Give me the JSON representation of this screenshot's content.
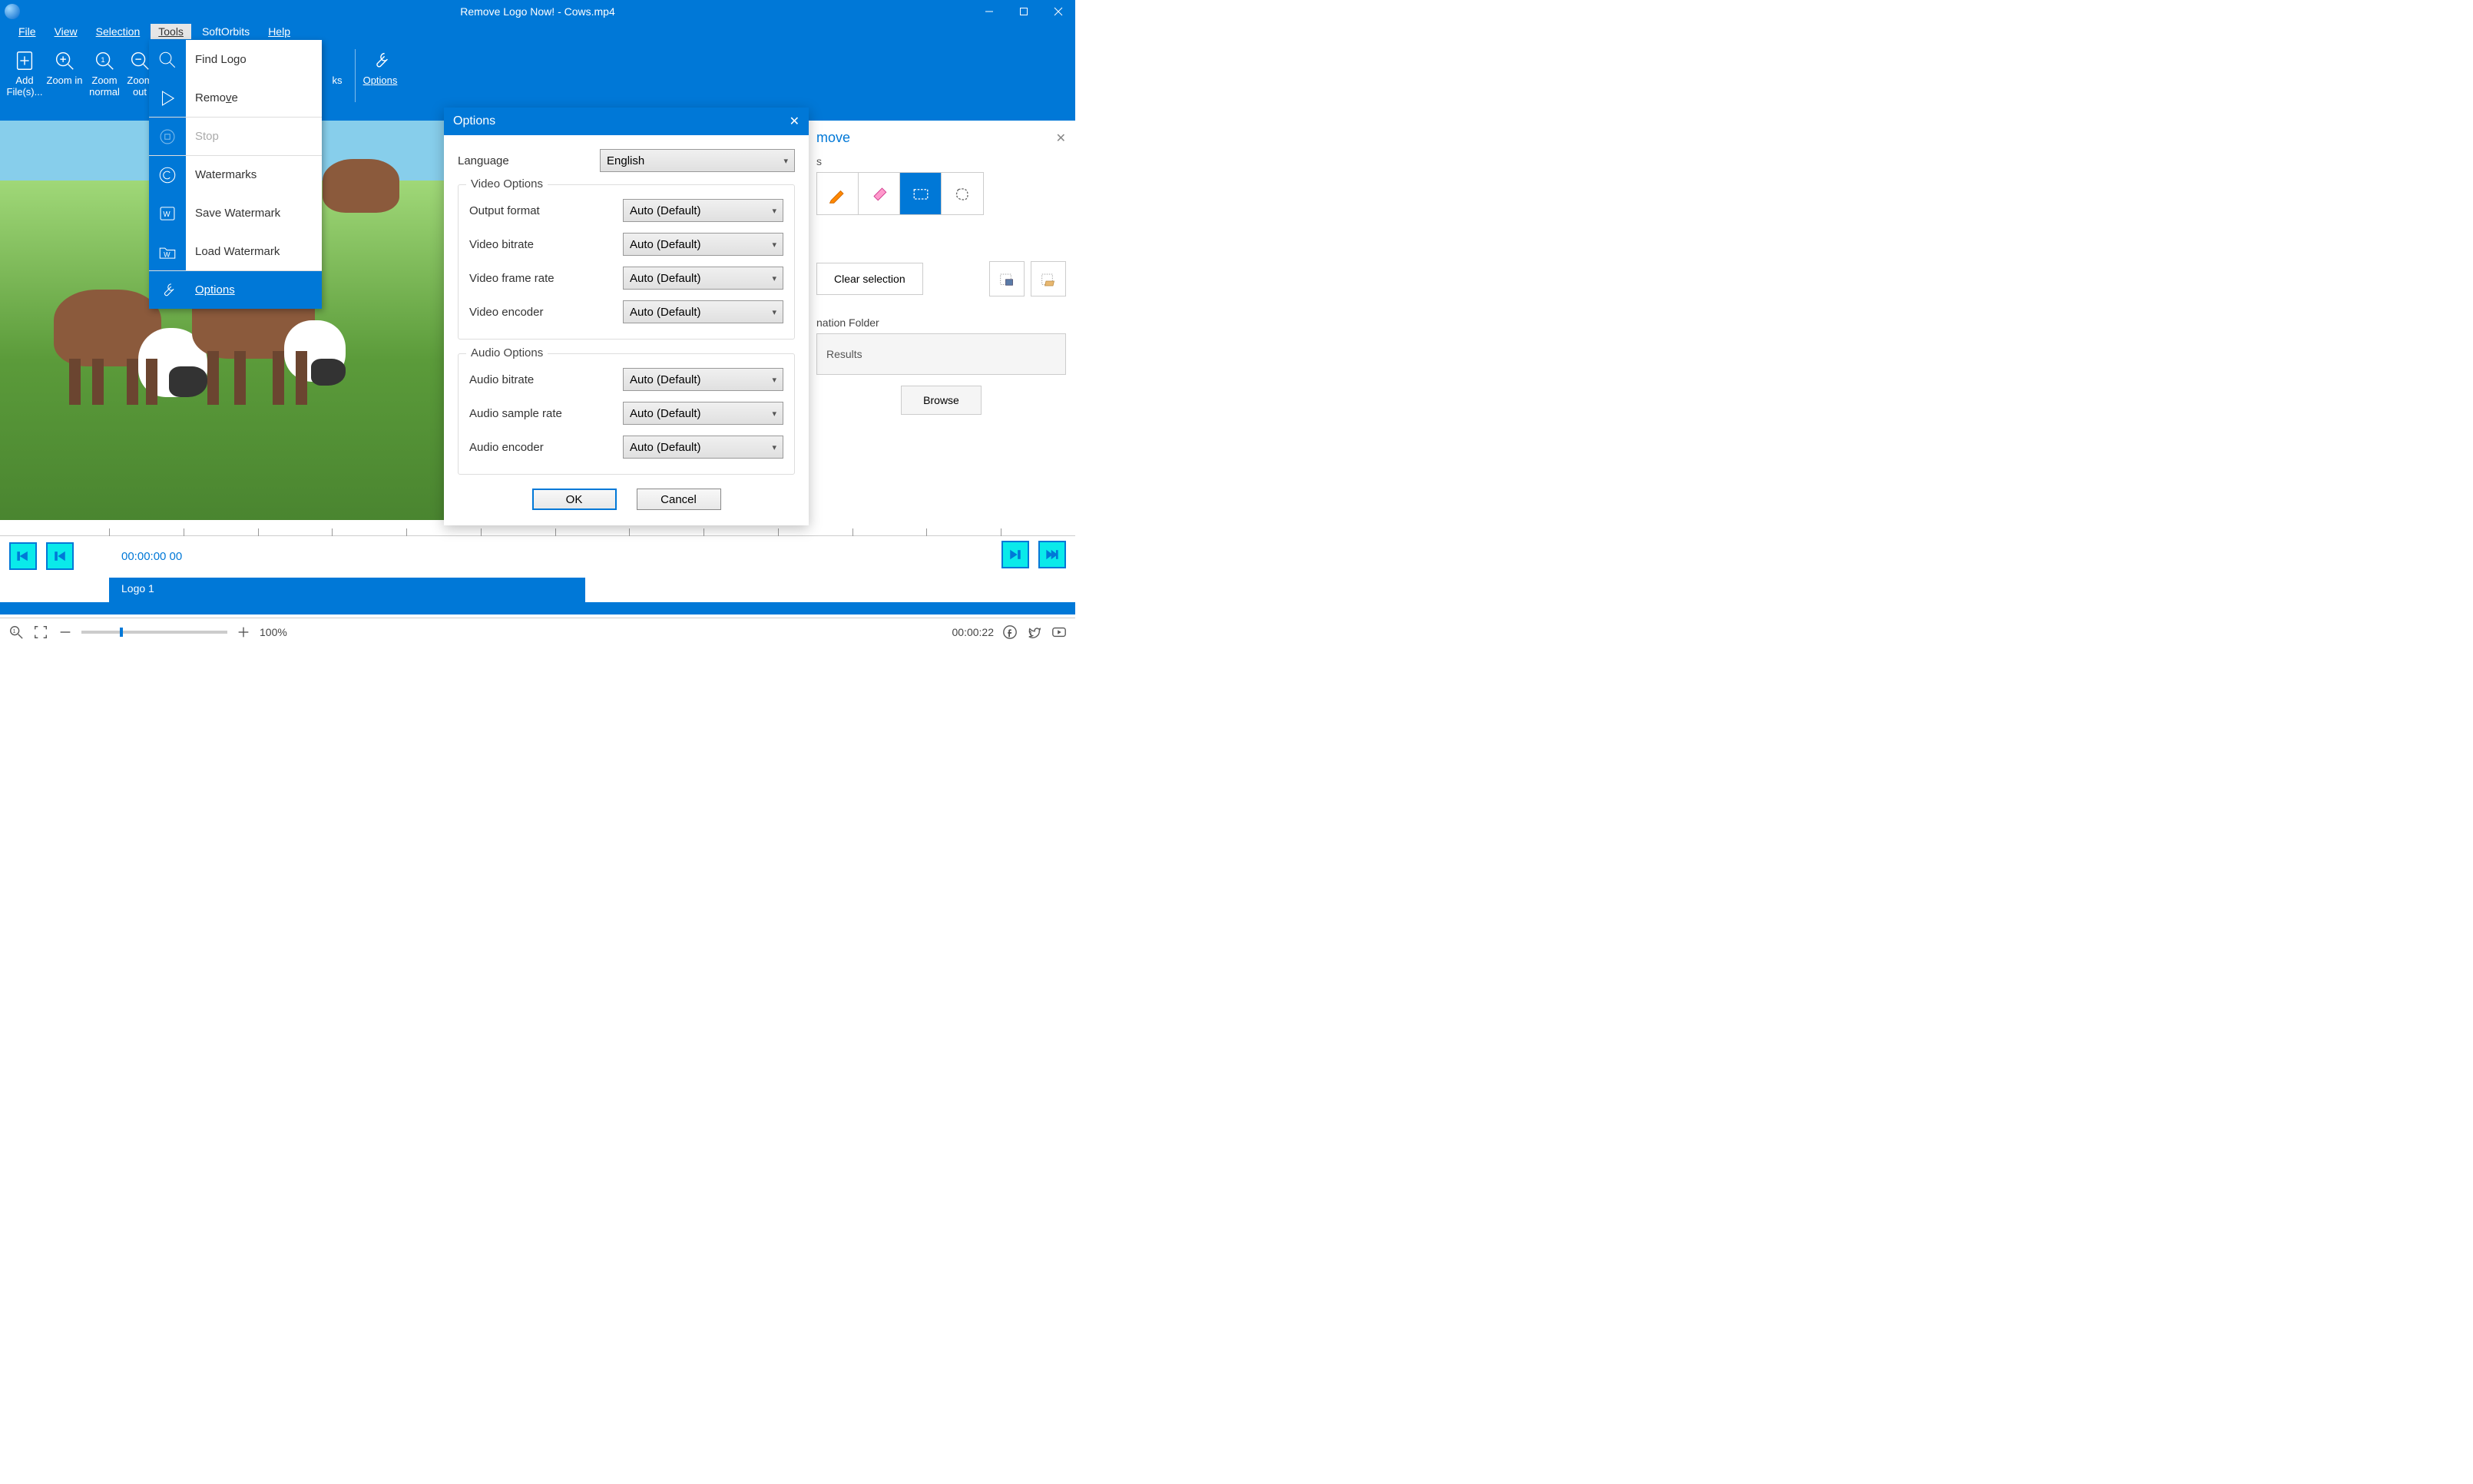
{
  "titlebar": {
    "title": "Remove Logo Now! - Cows.mp4"
  },
  "menubar": {
    "file": "File",
    "view": "View",
    "selection": "Selection",
    "tools": "Tools",
    "softorbits": "SoftOrbits",
    "help": "Help"
  },
  "toolbar": {
    "add_files": "Add File(s)...",
    "zoom_in": "Zoom in",
    "zoom_normal": "Zoom normal",
    "zoom_out": "Zoom out",
    "watermarks_hidden": "ks",
    "options": "Options"
  },
  "tools_menu": {
    "find_logo": "Find Logo",
    "remove": "Remove",
    "stop": "Stop",
    "watermarks": "Watermarks",
    "save_watermark": "Save Watermark",
    "load_watermark": "Load Watermark",
    "options": "Options"
  },
  "right_panel": {
    "title_suffix": "move",
    "tools_label": "s",
    "clear_selection": "Clear selection",
    "dest_label": "nation Folder",
    "dest_value": "Results",
    "browse": "Browse"
  },
  "dialog": {
    "title": "Options",
    "language_label": "Language",
    "language_value": "English",
    "video_legend": "Video Options",
    "output_format_label": "Output format",
    "output_format_value": "Auto (Default)",
    "video_bitrate_label": "Video bitrate",
    "video_bitrate_value": "Auto (Default)",
    "video_framerate_label": "Video frame rate",
    "video_framerate_value": "Auto (Default)",
    "video_encoder_label": "Video encoder",
    "video_encoder_value": "Auto (Default)",
    "audio_legend": "Audio Options",
    "audio_bitrate_label": "Audio bitrate",
    "audio_bitrate_value": "Auto (Default)",
    "audio_samplerate_label": "Audio sample rate",
    "audio_samplerate_value": "Auto (Default)",
    "audio_encoder_label": "Audio encoder",
    "audio_encoder_value": "Auto (Default)",
    "ok": "OK",
    "cancel": "Cancel"
  },
  "timeline": {
    "current_time": "00:00:00 00",
    "track_label": "Logo 1"
  },
  "bottombar": {
    "zoom_pct": "100%",
    "duration": "00:00:22"
  }
}
